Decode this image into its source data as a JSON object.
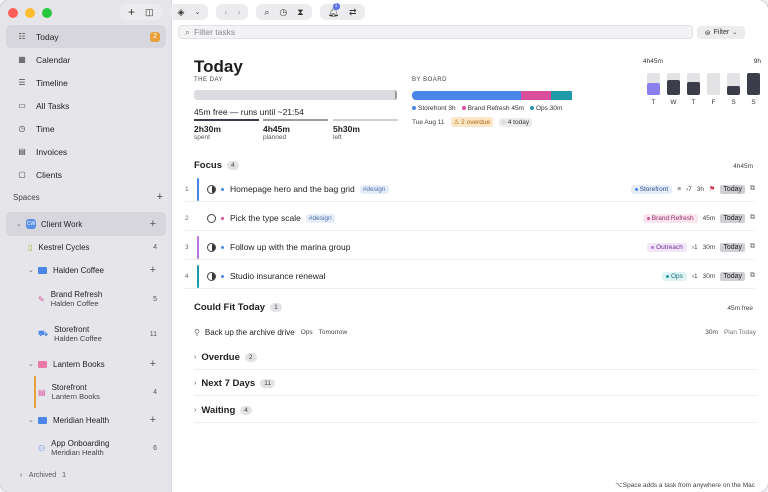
{
  "sidebar": {
    "nav": [
      {
        "label": "Today",
        "icon": "checklist-icon",
        "badge": "2"
      },
      {
        "label": "Calendar",
        "icon": "calendar-icon"
      },
      {
        "label": "Timeline",
        "icon": "timeline-icon"
      },
      {
        "label": "All Tasks",
        "icon": "inbox-icon"
      },
      {
        "label": "Time",
        "icon": "clock-icon"
      },
      {
        "label": "Invoices",
        "icon": "invoice-icon"
      },
      {
        "label": "Clients",
        "icon": "clients-icon"
      }
    ],
    "spaces_label": "Spaces",
    "tree": {
      "client_work": {
        "label": "Client Work",
        "badge": "CW"
      },
      "kestrel": {
        "label": "Kestrel Cycles",
        "count": "4"
      },
      "halden": {
        "label": "Halden Coffee"
      },
      "brand_refresh": {
        "label": "Brand Refresh",
        "sub": "Halden Coffee",
        "count": "5"
      },
      "storefront_halden": {
        "label": "Storefront",
        "sub": "Halden Coffee",
        "count": "11"
      },
      "lantern": {
        "label": "Lantern Books"
      },
      "storefront_lantern": {
        "label": "Storefront",
        "sub": "Lantern Books",
        "count": "4"
      },
      "meridian": {
        "label": "Meridian Health"
      },
      "app_onboarding": {
        "label": "App Onboarding",
        "sub": "Meridian Health",
        "count": "6"
      }
    },
    "archived": "Archived",
    "archived_count": "1"
  },
  "toolbar": {
    "notification_count": "1"
  },
  "filter": {
    "placeholder": "Filter tasks",
    "button": "Filter"
  },
  "page": {
    "title": "Today",
    "the_day_label": "THE DAY",
    "free_text": "45m free — runs until ~21:54",
    "stats": [
      {
        "value": "2h30m",
        "caption": "spent"
      },
      {
        "value": "4h45m",
        "caption": "planned"
      },
      {
        "value": "5h30m",
        "caption": "left"
      }
    ],
    "by_board_label": "BY BOARD",
    "boards": [
      {
        "name": "Storefront",
        "time": "3h",
        "color": "#4a86e8",
        "share": 0.53
      },
      {
        "name": "Brand Refresh",
        "time": "45m",
        "color": "#d94f9c",
        "share": 0.15
      },
      {
        "name": "Ops",
        "time": "30m",
        "color": "#1e9aa8",
        "share": 0.1
      }
    ],
    "date": "Tue Aug 11",
    "overdue_chip": "2 overdue",
    "today_chip": "4 today",
    "week": {
      "top_left": "4h45m",
      "top_right": "9h",
      "days": [
        {
          "d": "T",
          "level": 0.55,
          "color": "#8b7ff0"
        },
        {
          "d": "W",
          "level": 0.7,
          "color": "#3b3d4a"
        },
        {
          "d": "T",
          "level": 0.6,
          "color": "#3b3d4a"
        },
        {
          "d": "F",
          "level": 0.0,
          "color": "#3b3d4a"
        },
        {
          "d": "S",
          "level": 0.4,
          "color": "#3b3d4a"
        },
        {
          "d": "S",
          "level": 1.0,
          "color": "#3b3d4a"
        }
      ]
    }
  },
  "focus": {
    "title": "Focus",
    "count": "4",
    "total": "4h45m",
    "tasks": [
      {
        "num": "1",
        "title": "Homepage hero and the bag grid",
        "tag": "#design",
        "board": "Storefront",
        "meta": "7",
        "time": "3h",
        "today": "Today"
      },
      {
        "num": "2",
        "title": "Pick the type scale",
        "tag": "#design",
        "board": "Brand Refresh",
        "time": "45m",
        "today": "Today"
      },
      {
        "num": "3",
        "title": "Follow up with the marina group",
        "board": "Outreach",
        "meta": "1",
        "time": "30m",
        "today": "Today"
      },
      {
        "num": "4",
        "title": "Studio insurance renewal",
        "board": "Ops",
        "meta": "1",
        "time": "30m",
        "today": "Today"
      }
    ]
  },
  "could_fit": {
    "title": "Could Fit Today",
    "count": "1",
    "total": "45m free",
    "task": {
      "title": "Back up the archive drive",
      "board": "Ops",
      "when": "Tomorrow",
      "time": "30m",
      "action": "Plan Today"
    }
  },
  "collapsed": [
    {
      "title": "Overdue",
      "count": "2"
    },
    {
      "title": "Next 7 Days",
      "count": "11"
    },
    {
      "title": "Waiting",
      "count": "4"
    }
  ],
  "footer": "⌥Space adds a task from anywhere on the Mac"
}
